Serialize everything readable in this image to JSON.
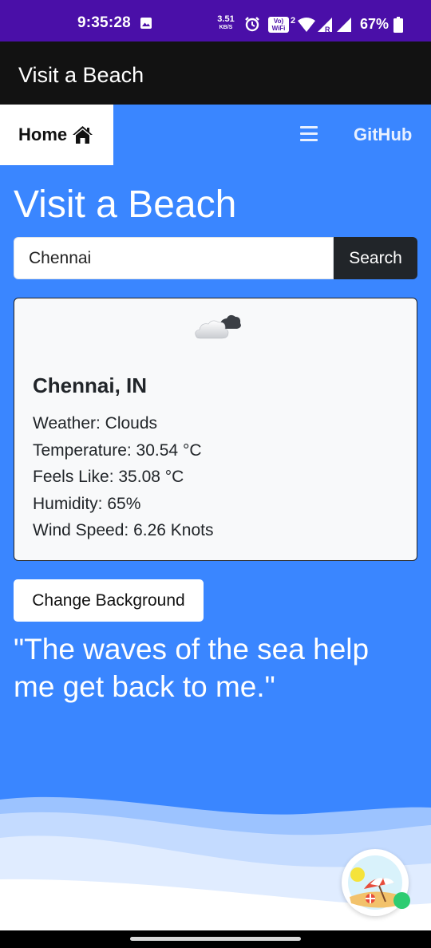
{
  "status_bar": {
    "time": "9:35:28",
    "net_rate": "3.51",
    "net_unit": "KB/S",
    "volte_label_top": "Vo)",
    "volte_label_bottom": "WiFi",
    "volte_num": "2",
    "signal_label": "R",
    "battery": "67%",
    "icons": [
      "image-icon",
      "alarm-icon",
      "volte-icon",
      "wifi-icon",
      "signal-icon",
      "battery-icon"
    ],
    "color": "#4a0fa8"
  },
  "app_bar": {
    "title": "Visit a Beach"
  },
  "nav": {
    "home_label": "Home",
    "home_icon": "home-icon",
    "menu_icon": "hamburger-menu-icon",
    "github_label": "GitHub"
  },
  "main": {
    "title": "Visit a Beach",
    "search": {
      "value": "Chennai",
      "button_label": "Search"
    },
    "weather": {
      "icon": "cloud-icon",
      "city": "Chennai, IN",
      "lines": [
        "Weather: Clouds",
        "Temperature: 30.54 °C",
        "Feels Like: 35.08 °C",
        "Humidity: 65%",
        "Wind Speed: 6.26 Knots"
      ]
    },
    "change_background_label": "Change Background",
    "quote": "\"The waves of the sea help me get back to me.\""
  },
  "floating_badge": {
    "icon": "beach-umbrella-icon"
  },
  "colors": {
    "page_background": "#3a86ff",
    "app_bar": "#121212",
    "dark_button": "#212529",
    "card_background": "#f8f9fa"
  }
}
